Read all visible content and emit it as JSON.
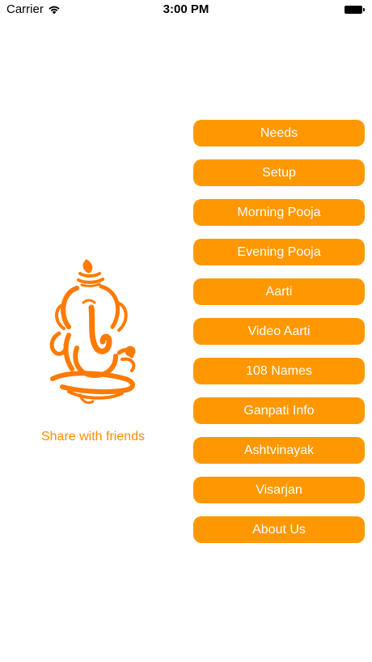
{
  "status_bar": {
    "carrier": "Carrier",
    "time": "3:00 PM",
    "wifi_icon": "wifi-icon",
    "battery_icon": "battery-icon"
  },
  "logo": {
    "icon": "ganesha-icon",
    "color": "#ff7a00"
  },
  "share": {
    "label": "Share with friends",
    "color": "#ff8c00"
  },
  "menu": {
    "button_color": "#ff9800",
    "items": [
      {
        "label": "Needs"
      },
      {
        "label": "Setup"
      },
      {
        "label": "Morning Pooja"
      },
      {
        "label": "Evening Pooja"
      },
      {
        "label": "Aarti"
      },
      {
        "label": "Video Aarti"
      },
      {
        "label": "108 Names"
      },
      {
        "label": "Ganpati Info"
      },
      {
        "label": "Ashtvinayak"
      },
      {
        "label": "Visarjan"
      },
      {
        "label": "About Us"
      }
    ]
  }
}
